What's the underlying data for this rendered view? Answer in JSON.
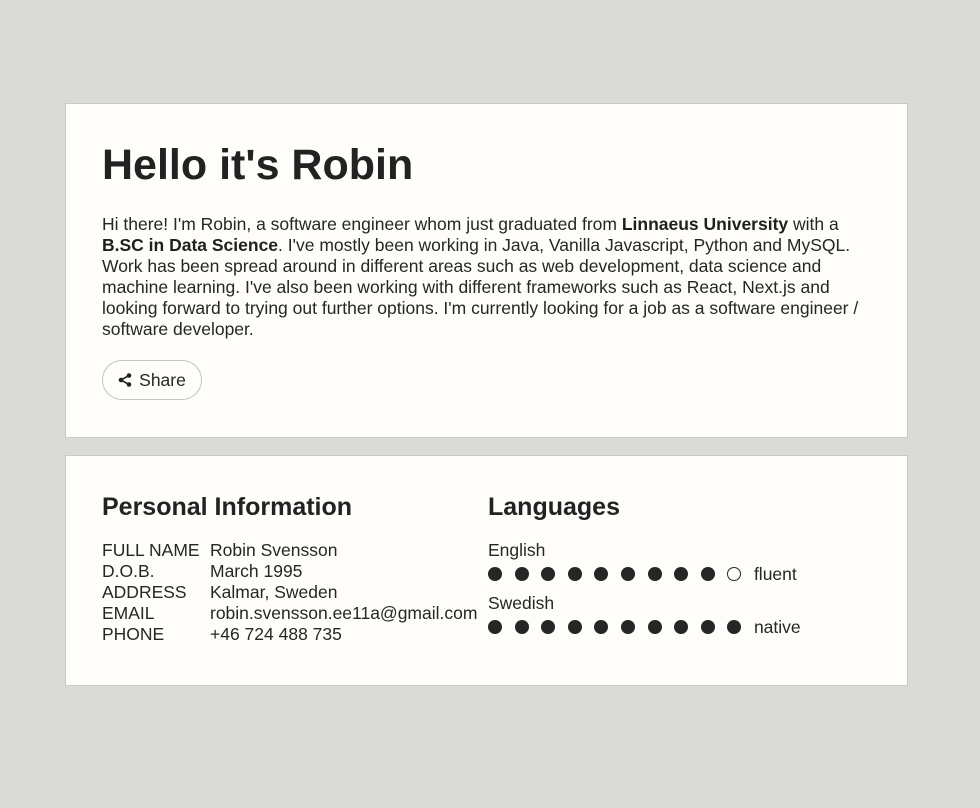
{
  "intro": {
    "title": "Hello it's Robin",
    "bio": {
      "p1": "Hi there! I'm Robin, a software engineer whom just graduated from ",
      "b1": "Linnaeus University",
      "p2": " with a ",
      "b2": "B.SC in Data Science",
      "p3": ". I've mostly been working in Java, Vanilla Javascript, Python and MySQL. Work has been spread around in different areas such as web development, data science and machine learning. I've also been working with different frameworks such as React, Next.js and looking forward to trying out further options. I'm currently looking for a job as a software engineer / software developer."
    },
    "share_label": "Share",
    "share_icon": "share-icon"
  },
  "personal": {
    "title": "Personal Information",
    "rows": [
      {
        "key": "FULL NAME",
        "value": "Robin Svensson"
      },
      {
        "key": "D.O.B.",
        "value": "March 1995"
      },
      {
        "key": "ADDRESS",
        "value": "Kalmar, Sweden"
      },
      {
        "key": "EMAIL",
        "value": "robin.svensson.ee11a@gmail.com"
      },
      {
        "key": "PHONE",
        "value": "+46 724 488 735"
      }
    ]
  },
  "languages": {
    "title": "Languages",
    "items": [
      {
        "name": "English",
        "rating": 9,
        "max": 10,
        "level": "fluent"
      },
      {
        "name": "Swedish",
        "rating": 10,
        "max": 10,
        "level": "native"
      }
    ]
  },
  "colors": {
    "background": "#dadad9",
    "card": "#fefdfa",
    "text": "#262626"
  }
}
